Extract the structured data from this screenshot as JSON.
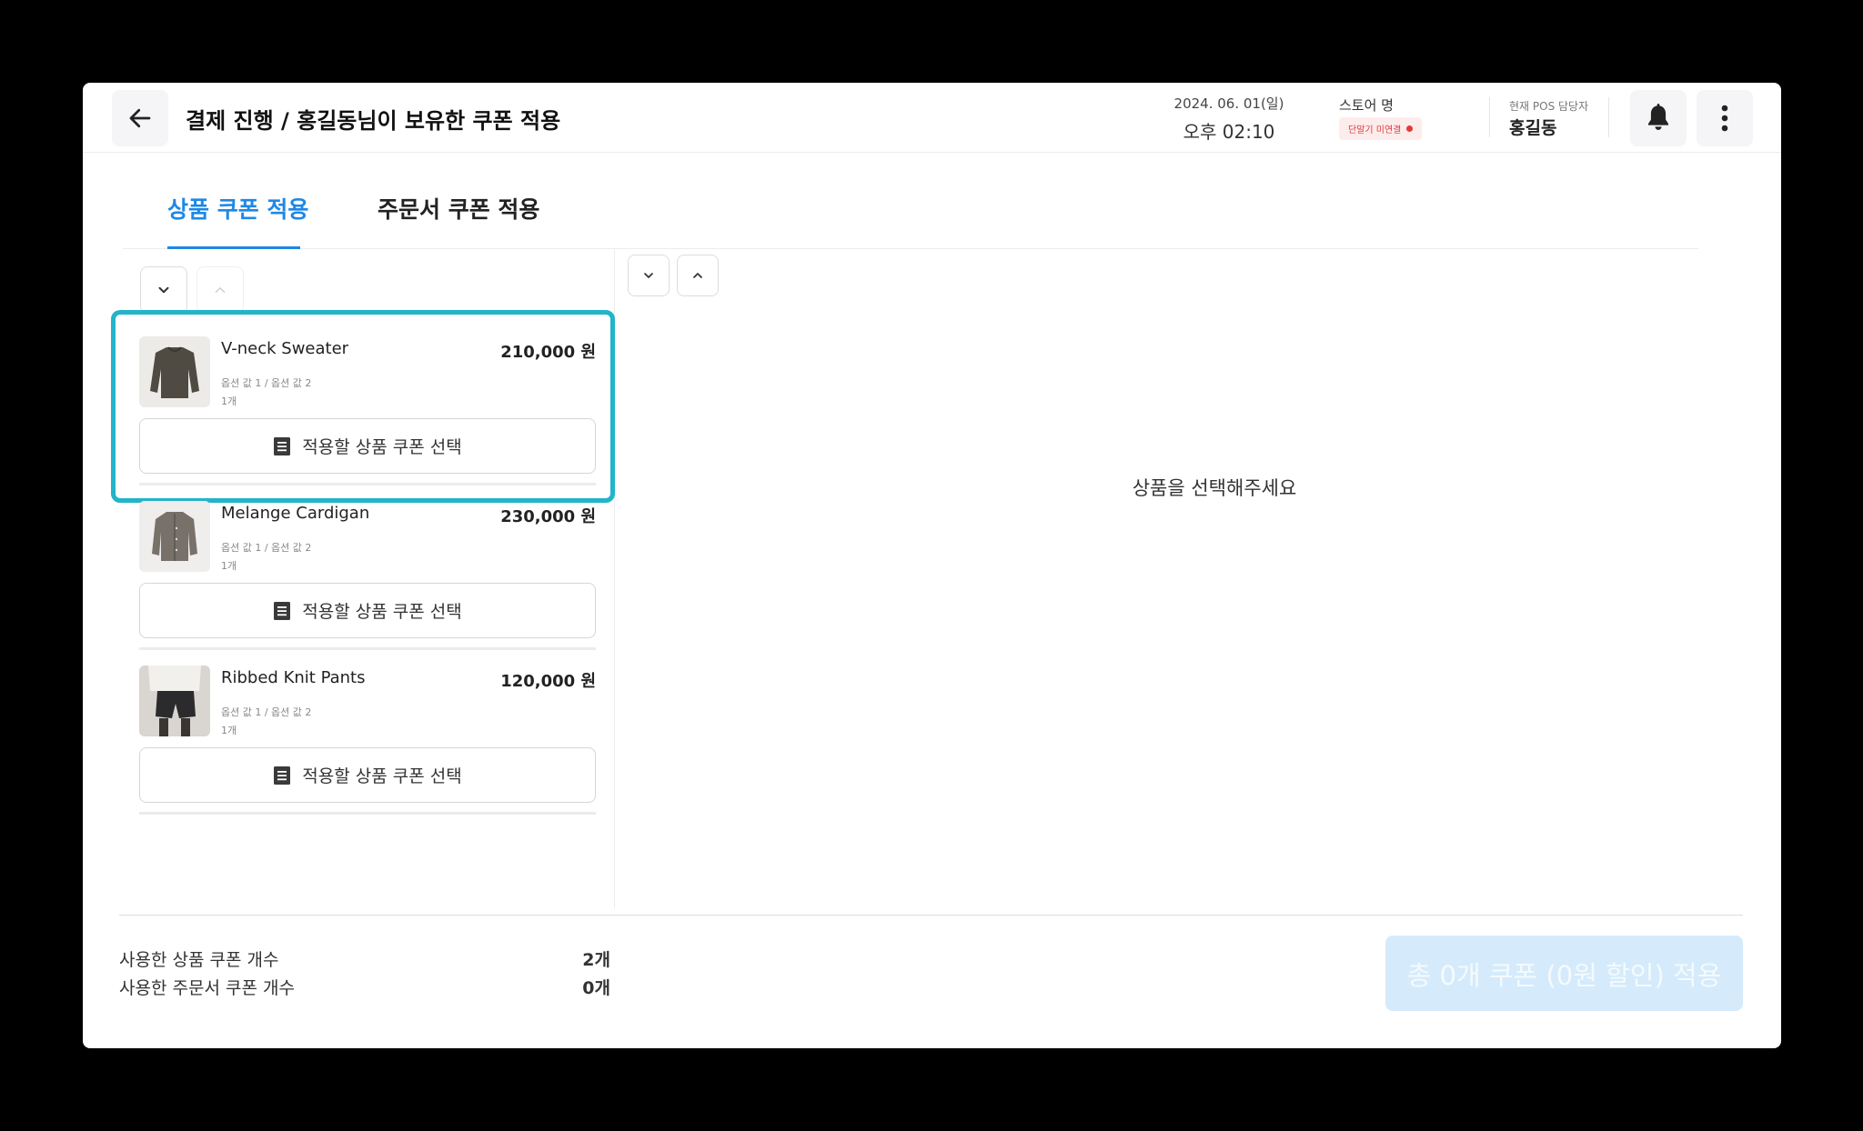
{
  "header": {
    "title": "결제 진행 / 홍길동님이 보유한 쿠폰 적용",
    "date": "2024. 06. 01(일)",
    "time": "오후 02:10",
    "store_label": "스토어 명",
    "terminal_status": "단말기 미연결",
    "staff_label": "현재 POS 담당자",
    "staff_name": "홍길동",
    "icons": [
      "arrow-left-icon",
      "bell-icon",
      "more-vertical-icon"
    ]
  },
  "tabs": [
    {
      "label": "상품 쿠폰 적용",
      "active": true
    },
    {
      "label": "주문서 쿠폰 적용",
      "active": false
    }
  ],
  "products": [
    {
      "name": "V-neck Sweater",
      "price": "210,000 원",
      "options": "옵션 값 1 / 옵션 값 2",
      "qty": "1개",
      "coupon_button": "적용할 상품 쿠폰 선택",
      "selected": true
    },
    {
      "name": "Melange Cardigan",
      "price": "230,000 원",
      "options": "옵션 값 1 / 옵션 값 2",
      "qty": "1개",
      "coupon_button": "적용할 상품 쿠폰 선택",
      "selected": false
    },
    {
      "name": "Ribbed Knit Pants",
      "price": "120,000 원",
      "options": "옵션 값 1 / 옵션 값 2",
      "qty": "1개",
      "coupon_button": "적용할 상품 쿠폰 선택",
      "selected": false
    }
  ],
  "detail": {
    "empty_message": "상품을 선택해주세요"
  },
  "summary": {
    "product_coupon_label": "사용한 상품 쿠폰 개수",
    "product_coupon_value": "2개",
    "order_coupon_label": "사용한 주문서 쿠폰 개수",
    "order_coupon_value": "0개"
  },
  "apply_button": "총 0개 쿠폰 (0원 할인) 적용",
  "colors": {
    "accent": "#1e88e5",
    "selection_border": "#22b4c8",
    "status_red": "#e53935",
    "disabled_button": "#d5ebfb"
  }
}
